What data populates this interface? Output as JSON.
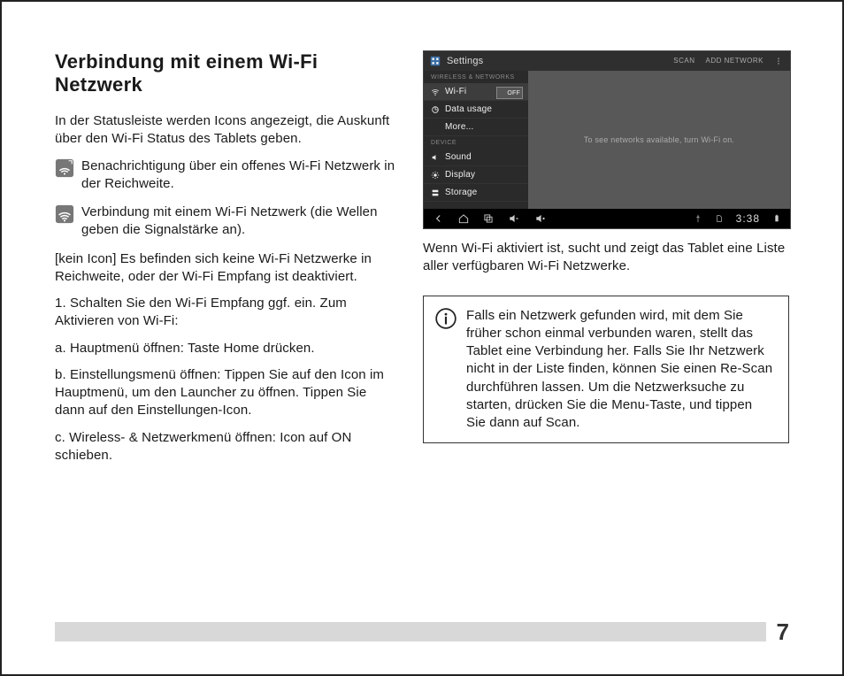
{
  "title": "Verbindung mit einem Wi-Fi Netzwerk",
  "intro": "In der Statusleiste werden Icons angezeigt, die Auskunft über den Wi-Fi Status des Tablets geben.",
  "notify_open": "Benachrichtigung über ein offenes Wi-Fi Netzwerk in der Reichweite.",
  "connected": "Verbindung mit einem Wi-Fi Netzwerk (die Wellen geben die Signalstärke an).",
  "no_icon": "[kein Icon] Es befinden sich keine Wi-Fi Netzwerke in Reichweite, oder der Wi-Fi Empfang ist deaktiviert.",
  "step1": "1. Schalten Sie den Wi-Fi Empfang ggf. ein. Zum Aktivieren von Wi-Fi:",
  "step1a": "a. Hauptmenü öffnen: Taste Home drücken.",
  "step1b": "b. Einstellungsmenü öffnen: Tippen Sie auf den Icon im Hauptmenü, um den Launcher zu öffnen. Tippen Sie dann auf den Einstellungen-Icon.",
  "step1c": "c. Wireless- & Netzwerkmenü öffnen: Icon auf ON schieben.",
  "right_intro": "Wenn Wi-Fi aktiviert ist, sucht und zeigt das Tablet eine Liste aller verfügbaren Wi-Fi Netzwerke.",
  "tip": "Falls ein Netzwerk gefunden wird, mit dem Sie früher schon einmal verbunden waren, stellt das Tablet eine Verbindung her. Falls Sie Ihr Netzwerk nicht in der Liste finden, können Sie einen Re-Scan durchführen lassen. Um die Netzwerksuche zu starten, drücken Sie die Menu-Taste, und tippen Sie dann auf Scan.",
  "page_number": "7",
  "screenshot": {
    "app_title": "Settings",
    "action_scan": "SCAN",
    "action_add": "ADD NETWORK",
    "section_wireless": "WIRELESS & NETWORKS",
    "row_wifi": "Wi-Fi",
    "wifi_toggle": "OFF",
    "row_data": "Data usage",
    "row_more": "More...",
    "section_device": "DEVICE",
    "row_sound": "Sound",
    "row_display": "Display",
    "row_storage": "Storage",
    "hint": "To see networks available, turn Wi-Fi on.",
    "clock": "3:38"
  }
}
